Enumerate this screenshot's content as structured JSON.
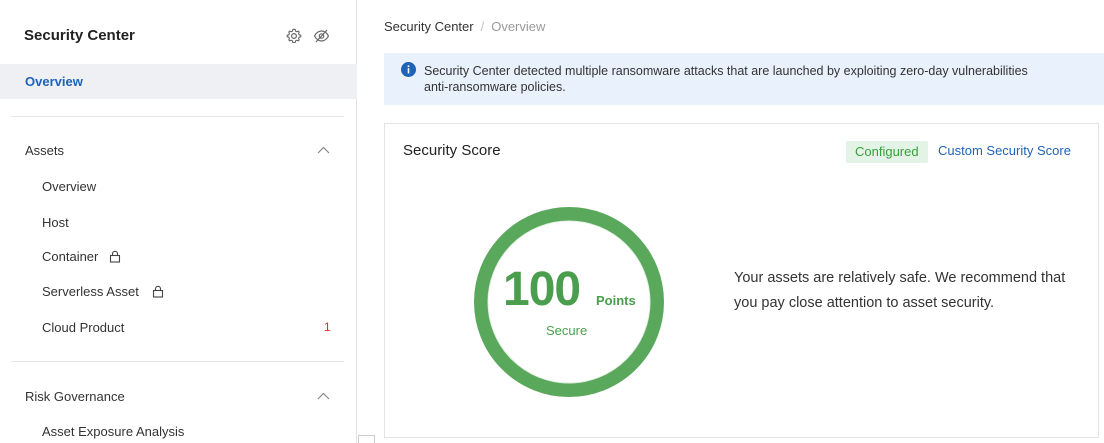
{
  "sidebar": {
    "title": "Security Center",
    "icons": {
      "settings": "gear-icon",
      "visibility": "eye-off-icon"
    },
    "overview_label": "Overview",
    "groups": [
      {
        "label": "Assets",
        "items": [
          {
            "label": "Overview",
            "locked": false,
            "count": ""
          },
          {
            "label": "Host",
            "locked": false,
            "count": ""
          },
          {
            "label": "Container",
            "locked": true,
            "count": ""
          },
          {
            "label": "Serverless Asset",
            "locked": true,
            "count": ""
          },
          {
            "label": "Cloud Product",
            "locked": false,
            "count": "1"
          }
        ]
      },
      {
        "label": "Risk Governance",
        "items": [
          {
            "label": "Asset Exposure Analysis",
            "locked": false,
            "count": ""
          }
        ]
      }
    ]
  },
  "breadcrumb": {
    "root": "Security Center",
    "separator": "/",
    "current": "Overview"
  },
  "notice": {
    "icon": "info-icon",
    "line1": "Security Center detected multiple ransomware attacks that are launched by exploiting zero-day vulnerabilities",
    "line2": "anti-ransomware policies."
  },
  "score_card": {
    "title": "Security Score",
    "status_badge": "Configured",
    "custom_link": "Custom Security Score",
    "score": "100",
    "unit": "Points",
    "level": "Secure",
    "description": "Your assets are relatively safe. We recommend that you pay close attention to asset security."
  },
  "colors": {
    "accent": "#1e63b8",
    "success": "#4a9e4d",
    "badge_bg": "#e3f3e5",
    "notice_bg": "#e9f1fc",
    "count_red": "#d93026"
  }
}
